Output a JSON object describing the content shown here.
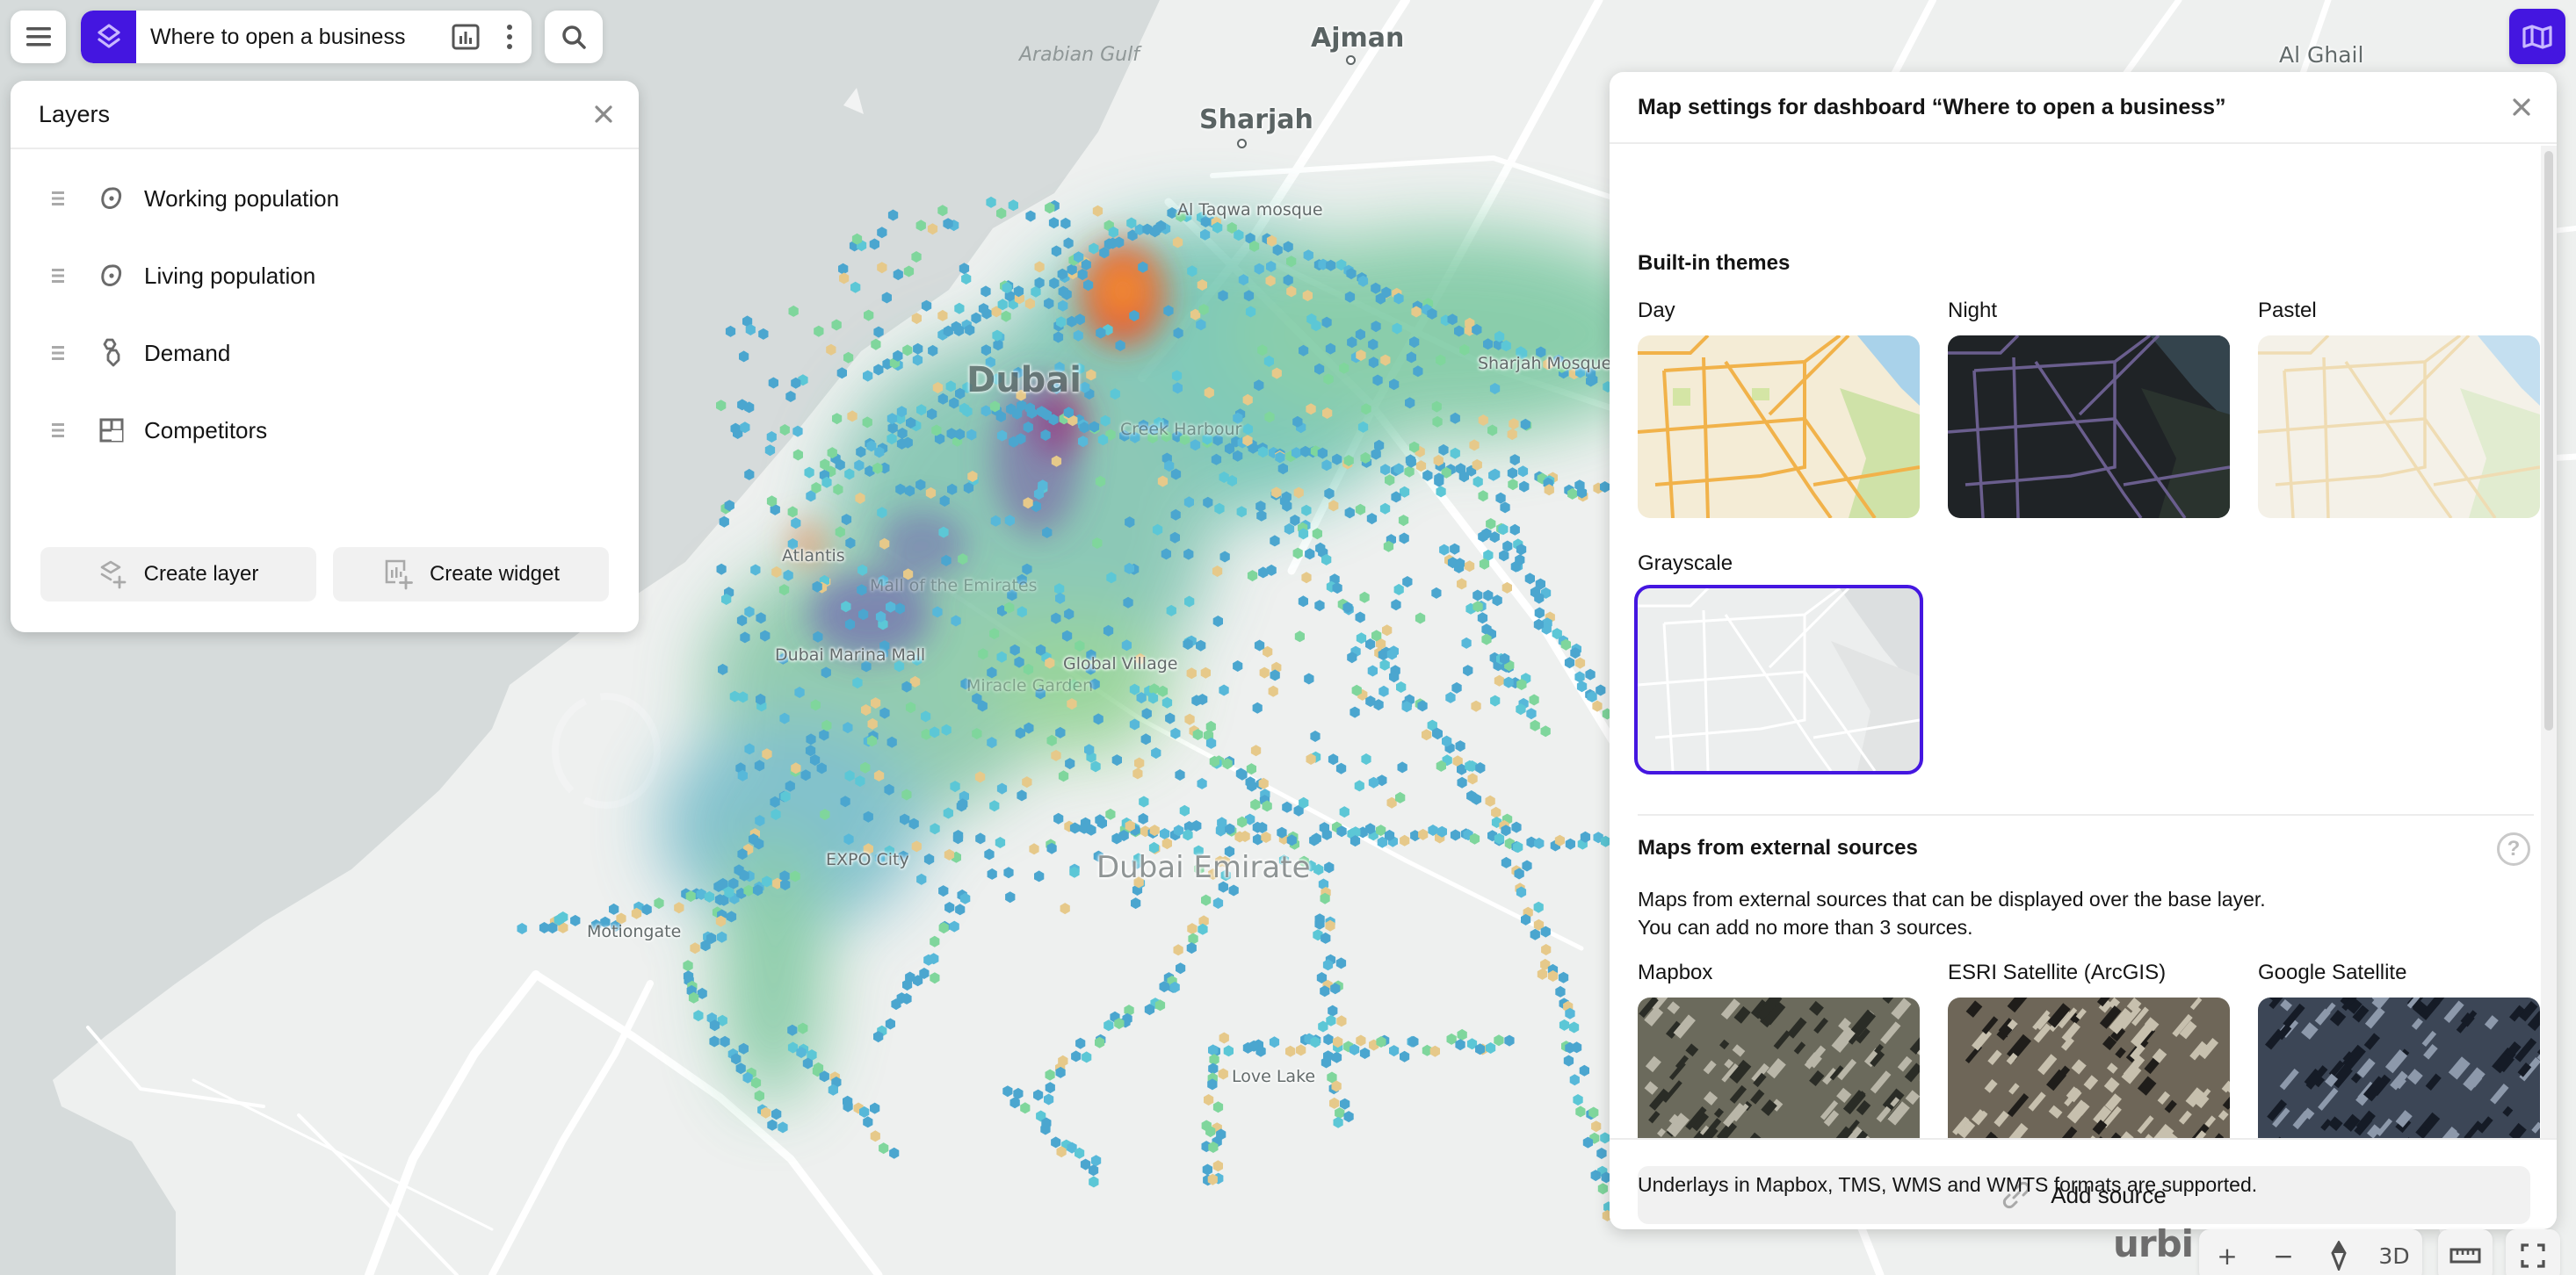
{
  "app": {
    "accent_color": "#4416e0",
    "dashboard_title": "Where to open a business"
  },
  "toolbar": {
    "menu_icon": "hamburger-icon",
    "layers_icon": "layers-icon",
    "widgets_icon": "chart-widget-icon",
    "more_icon": "more-vertical-icon",
    "search_icon": "search-icon"
  },
  "layers_panel": {
    "title": "Layers",
    "close_icon": "close-icon",
    "layers": [
      {
        "name": "Working population",
        "icon": "heatmap-blob-icon"
      },
      {
        "name": "Living population",
        "icon": "heatmap-blob-icon"
      },
      {
        "name": "Demand",
        "icon": "hexagon-grid-icon"
      },
      {
        "name": "Competitors",
        "icon": "square-grid-icon"
      }
    ],
    "create_layer_label": "Create layer",
    "create_widget_label": "Create widget"
  },
  "map_settings_button": {
    "icon": "map-icon"
  },
  "settings_panel": {
    "title": "Map settings for dashboard “Where to open a business”",
    "builtin_themes": {
      "title": "Built-in themes",
      "themes": [
        {
          "label": "Day",
          "selected": false
        },
        {
          "label": "Night",
          "selected": false
        },
        {
          "label": "Pastel",
          "selected": false
        },
        {
          "label": "Grayscale",
          "selected": true
        }
      ]
    },
    "external_sources": {
      "title": "Maps from external sources",
      "description_line1": "Maps from external sources that can be displayed over the base layer.",
      "description_line2": "You can add no more than 3 sources.",
      "sources": [
        {
          "label": "Mapbox"
        },
        {
          "label": "ESRI Satellite (ArcGIS)"
        },
        {
          "label": "Google Satellite"
        }
      ]
    },
    "add_source_label": "Add source",
    "formats_note": "Underlays in Mapbox, TMS, WMS and WMTS formats are supported."
  },
  "map": {
    "labels": {
      "sea": "Arabian Gulf",
      "ajman": "Ajman",
      "sharjah": "Sharjah",
      "al_ghail": "Al Ghail",
      "al_taqwa": "Al Taqwa mosque",
      "sharjah_mosque": "Sharjah Mosque",
      "dubai": "Dubai",
      "creek_harbour": "Creek Harbour",
      "atlantis": "Atlantis",
      "mall_emirates": "Mall of the Emirates",
      "marina_mall": "Dubai Marina Mall",
      "global_village": "Global Village",
      "miracle_garden": "Miracle Garden",
      "expo_city": "EXPO City",
      "dubai_emirate": "Dubai Emirate",
      "motiongate": "Motiongate",
      "love_lake": "Love Lake"
    },
    "controls": {
      "brand": "urbi",
      "zoom_in": "+",
      "zoom_out": "−",
      "compass_icon": "compass-icon",
      "three_d": "3D",
      "ruler_icon": "ruler-icon",
      "fullscreen_icon": "fullscreen-icon"
    }
  }
}
